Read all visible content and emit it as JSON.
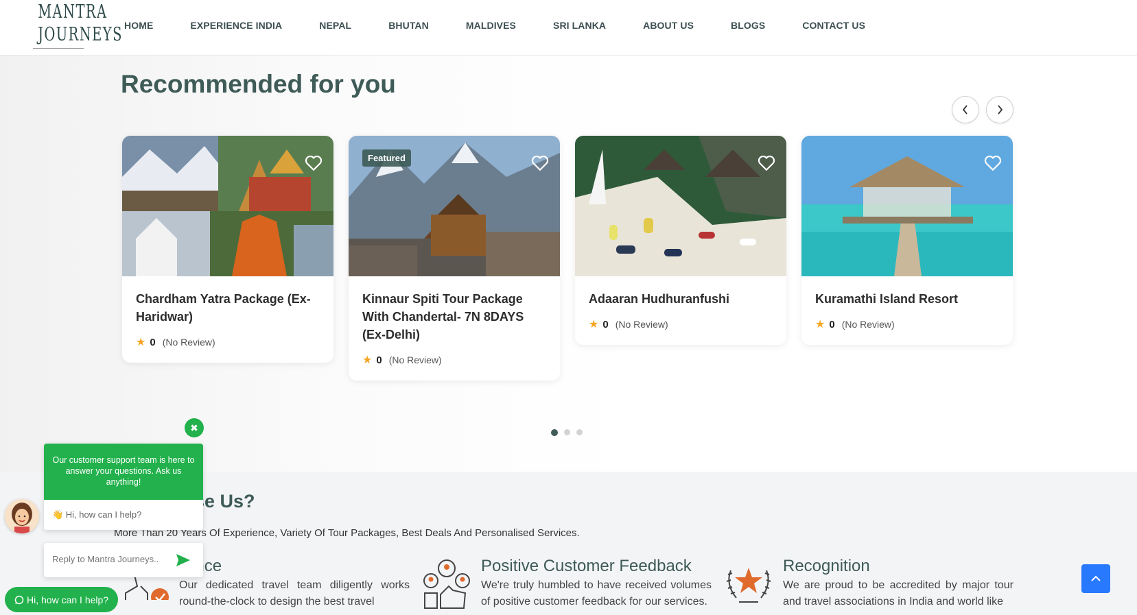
{
  "header": {
    "logo_line1": "MANTRA",
    "logo_line2": "JOURNEYS",
    "nav": [
      "HOME",
      "EXPERIENCE INDIA",
      "NEPAL",
      "BHUTAN",
      "MALDIVES",
      "SRI LANKA",
      "ABOUT US",
      "BLOGS",
      "CONTACT US"
    ]
  },
  "recommended": {
    "title": "Recommended for you",
    "cards": [
      {
        "title": "Chardham Yatra Package (Ex-Haridwar)",
        "rating": "0",
        "reviews": "(No Review)",
        "featured": ""
      },
      {
        "title": "Kinnaur Spiti Tour Package With Chandertal- 7N 8DAYS (Ex-Delhi)",
        "rating": "0",
        "reviews": "(No Review)",
        "featured": "Featured"
      },
      {
        "title": "Adaaran Hudhuranfushi",
        "rating": "0",
        "reviews": "(No Review)",
        "featured": ""
      },
      {
        "title": "Kuramathi Island Resort",
        "rating": "0",
        "reviews": "(No Review)",
        "featured": ""
      }
    ],
    "carousel_page": 1,
    "carousel_pages": 3
  },
  "why": {
    "title": "Why Choose Us?",
    "visible_title": "se Us?",
    "subtitle": "More Than 20 Years Of Experience, Variety Of Tour Packages, Best Deals And Personalised Services.",
    "features": [
      {
        "title": "perience",
        "text": "Our dedicated travel team diligently works round-the-clock to design the best travel"
      },
      {
        "title": "Positive Customer Feedback",
        "text": "We're truly humbled to have received volumes of positive customer feedback for our services."
      },
      {
        "title": "Recognition",
        "text": "We are proud to be accredited by major tour and travel associations in India and world like"
      }
    ]
  },
  "chat": {
    "header": "Our customer support team is here to answer your questions. Ask us anything!",
    "message": "👋 Hi, how can I help?",
    "placeholder": "Reply to Mantra Journeys..",
    "pill": "Hi, how can I help?"
  },
  "colors": {
    "brand": "#3e5b57",
    "chat_green": "#22b14c",
    "up_button": "#2979ff",
    "star": "#f5a623"
  }
}
